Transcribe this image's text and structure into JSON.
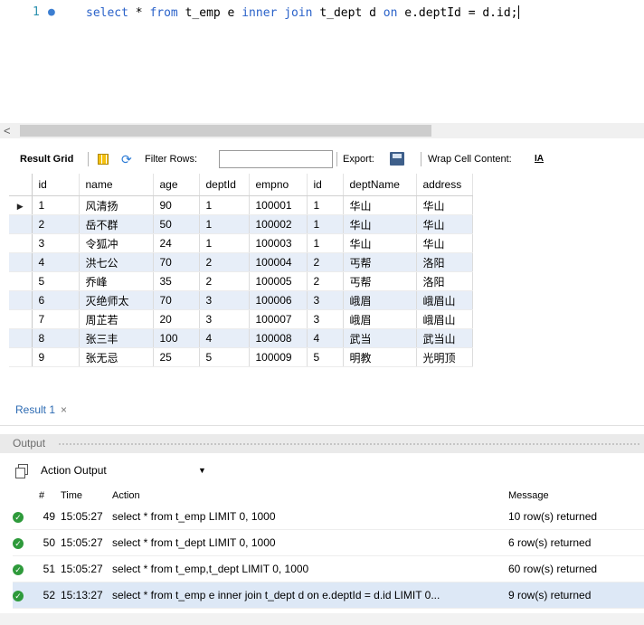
{
  "editor": {
    "line_number": "1",
    "line_marker": "●",
    "sql_tokens": [
      {
        "text": "select",
        "kw": true
      },
      {
        "text": " * ",
        "kw": false
      },
      {
        "text": "from",
        "kw": true
      },
      {
        "text": " t_emp e ",
        "kw": false
      },
      {
        "text": "inner",
        "kw": true
      },
      {
        "text": " ",
        "kw": false
      },
      {
        "text": "join",
        "kw": true
      },
      {
        "text": " t_dept d ",
        "kw": false
      },
      {
        "text": "on",
        "kw": true
      },
      {
        "text": " e.deptId = d.id;",
        "kw": false
      }
    ]
  },
  "scrollbar": {
    "left_arrow": "<"
  },
  "result_toolbar": {
    "title": "Result Grid",
    "filter_label": "Filter Rows:",
    "filter_value": "",
    "export_label": "Export:",
    "wrap_label": "Wrap Cell Content:",
    "wrap_icon": "IA",
    "icons": [
      "grid-icon",
      "refresh-icon",
      "export-icon",
      "wrap-icon"
    ]
  },
  "grid": {
    "columns": [
      "id",
      "name",
      "age",
      "deptId",
      "empno",
      "id",
      "deptName",
      "address"
    ],
    "rows": [
      [
        "1",
        "风清扬",
        "90",
        "1",
        "100001",
        "1",
        "华山",
        "华山"
      ],
      [
        "2",
        "岳不群",
        "50",
        "1",
        "100002",
        "1",
        "华山",
        "华山"
      ],
      [
        "3",
        "令狐冲",
        "24",
        "1",
        "100003",
        "1",
        "华山",
        "华山"
      ],
      [
        "4",
        "洪七公",
        "70",
        "2",
        "100004",
        "2",
        "丐帮",
        "洛阳"
      ],
      [
        "5",
        "乔峰",
        "35",
        "2",
        "100005",
        "2",
        "丐帮",
        "洛阳"
      ],
      [
        "6",
        "灭绝师太",
        "70",
        "3",
        "100006",
        "3",
        "峨眉",
        "峨眉山"
      ],
      [
        "7",
        "周芷若",
        "20",
        "3",
        "100007",
        "3",
        "峨眉",
        "峨眉山"
      ],
      [
        "8",
        "张三丰",
        "100",
        "4",
        "100008",
        "4",
        "武当",
        "武当山"
      ],
      [
        "9",
        "张无忌",
        "25",
        "5",
        "100009",
        "5",
        "明教",
        "光明顶"
      ]
    ],
    "current_row_marker": "▶"
  },
  "result_tab": {
    "label": "Result 1",
    "close": "×"
  },
  "output": {
    "header": "Output",
    "mode": "Action Output",
    "mode_arrow": "▼",
    "columns": [
      "#",
      "Time",
      "Action",
      "Message"
    ],
    "rows": [
      {
        "num": "49",
        "time": "15:05:27",
        "action": "select * from t_emp LIMIT 0, 1000",
        "message": "10 row(s) returned",
        "status": "ok"
      },
      {
        "num": "50",
        "time": "15:05:27",
        "action": "select * from t_dept LIMIT 0, 1000",
        "message": "6 row(s) returned",
        "status": "ok"
      },
      {
        "num": "51",
        "time": "15:05:27",
        "action": "select * from t_emp,t_dept LIMIT 0, 1000",
        "message": "60 row(s) returned",
        "status": "ok"
      },
      {
        "num": "52",
        "time": "15:13:27",
        "action": "select * from t_emp e inner join t_dept d on e.deptId = d.id LIMIT 0...",
        "message": "9 row(s) returned",
        "status": "ok"
      }
    ],
    "status_glyph": "✓"
  },
  "colors": {
    "keyword": "#2a62c9",
    "row_alt": "#e7eef8",
    "ok_green": "#2e9a3b",
    "tab_blue": "#2d6bb3"
  }
}
